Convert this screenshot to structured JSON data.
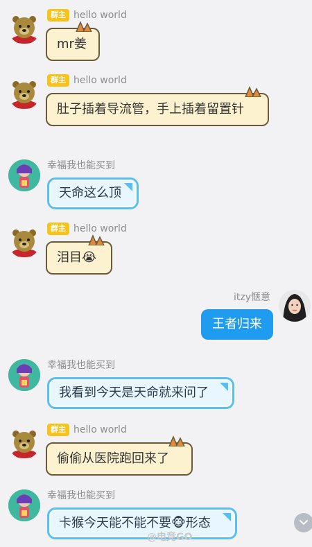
{
  "chat": {
    "badge_label": "群主",
    "messages": [
      {
        "sender": "hello world",
        "text": "mr姜"
      },
      {
        "sender": "hello world",
        "text": "肚子插着导流管，手上插着留置针"
      },
      {
        "sender": "幸福我也能买到",
        "text": "天命这么顶"
      },
      {
        "sender": "hello world",
        "text": "泪目😭"
      },
      {
        "sender": "itzy惬意",
        "text": "王者归来"
      },
      {
        "sender": "幸福我也能买到",
        "text": "我看到今天是天命就来问了"
      },
      {
        "sender": "hello world",
        "text": "偷偷从医院跑回来了"
      },
      {
        "sender": "幸福我也能买到",
        "text": "卡猴今天能不能不要🐵形态"
      }
    ]
  },
  "watermark": "@电竞GO",
  "icons": {
    "scroll_down": "chevron-down-icon"
  }
}
